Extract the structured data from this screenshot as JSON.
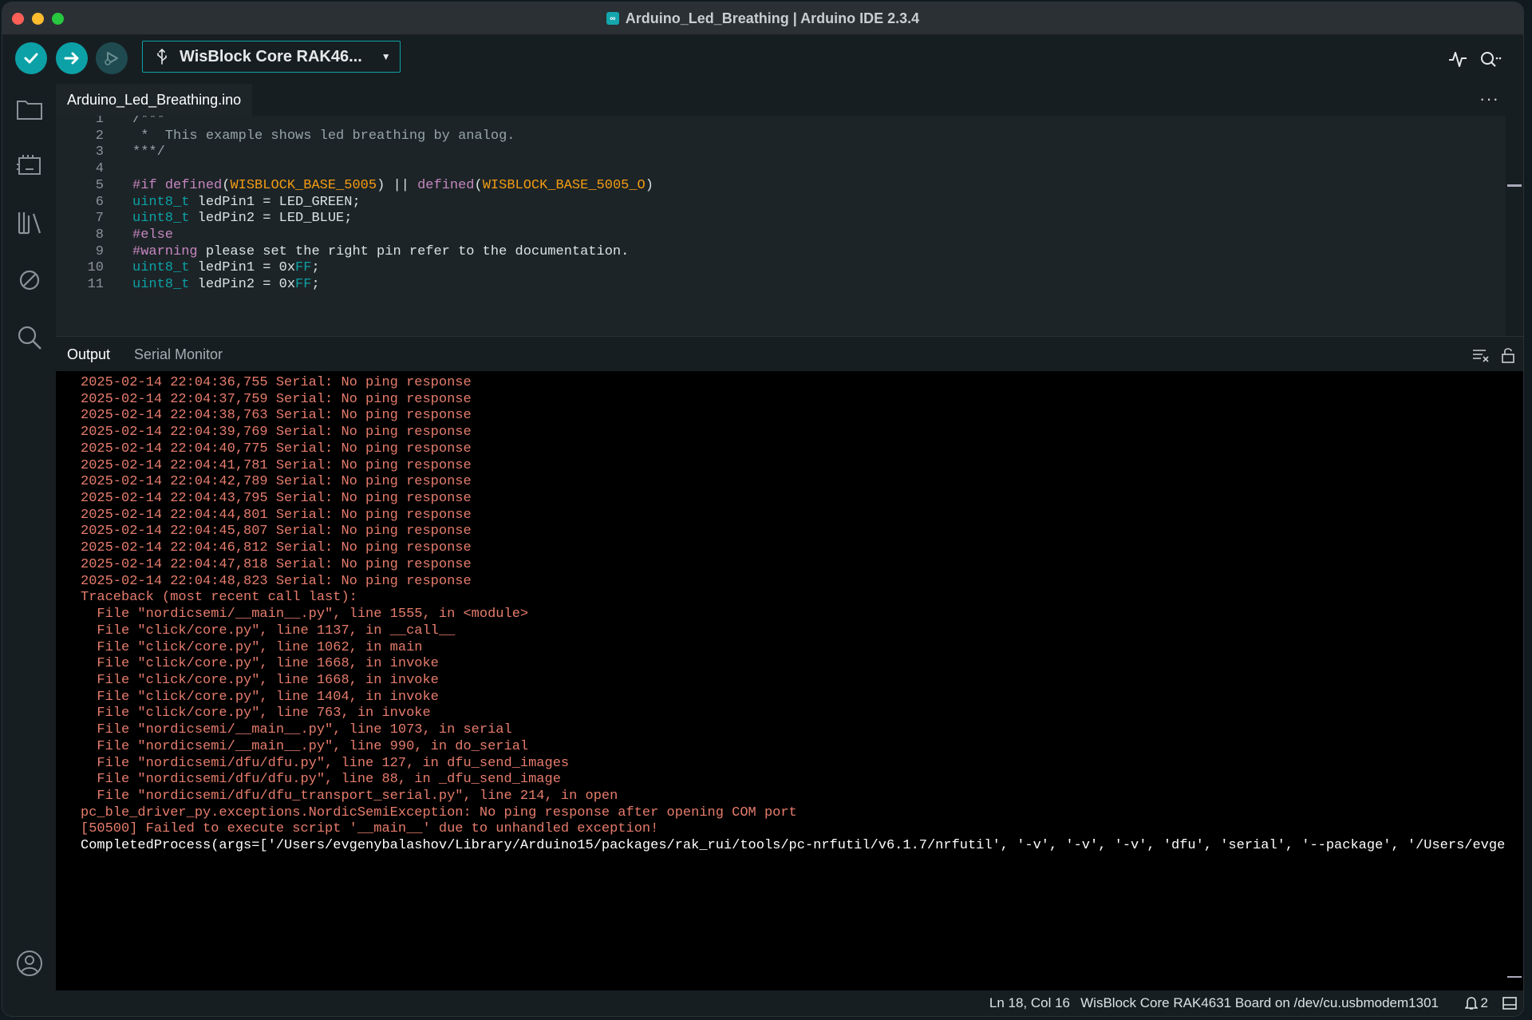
{
  "window": {
    "title": "Arduino_Led_Breathing | Arduino IDE 2.3.4"
  },
  "toolbar": {
    "board_selected": "WisBlock Core RAK46...",
    "icons": [
      "verify-icon",
      "upload-icon",
      "debug-icon",
      "usb-icon",
      "chevron-down-icon",
      "serial-plotter-icon",
      "serial-monitor-icon"
    ]
  },
  "activity_bar": {
    "icons": [
      "folder-icon",
      "boards-manager-icon",
      "library-manager-icon",
      "debug-icon",
      "search-icon",
      "account-icon"
    ]
  },
  "editor": {
    "file_tab": "Arduino_Led_Breathing.ino",
    "more_label": "···",
    "lines": [
      {
        "num": "1",
        "segments": [
          {
            "t": "/***",
            "c": "comment"
          }
        ]
      },
      {
        "num": "2",
        "segments": [
          {
            "t": " *  This example shows led breathing by analog.",
            "c": "comment"
          }
        ]
      },
      {
        "num": "3",
        "segments": [
          {
            "t": "***/",
            "c": "comment"
          }
        ]
      },
      {
        "num": "4",
        "segments": []
      },
      {
        "num": "5",
        "segments": [
          {
            "t": "#if ",
            "c": "pp"
          },
          {
            "t": "defined",
            "c": "pp"
          },
          {
            "t": "(",
            "c": "plain"
          },
          {
            "t": "WISBLOCK_BASE_5005",
            "c": "const"
          },
          {
            "t": ") || ",
            "c": "plain"
          },
          {
            "t": "defined",
            "c": "pp"
          },
          {
            "t": "(",
            "c": "plain"
          },
          {
            "t": "WISBLOCK_BASE_5005_O",
            "c": "const"
          },
          {
            "t": ")",
            "c": "plain"
          }
        ]
      },
      {
        "num": "6",
        "segments": [
          {
            "t": "uint8_t",
            "c": "kw"
          },
          {
            "t": " ledPin1 = LED_GREEN;",
            "c": "plain"
          }
        ]
      },
      {
        "num": "7",
        "segments": [
          {
            "t": "uint8_t",
            "c": "kw"
          },
          {
            "t": " ledPin2 = LED_BLUE;",
            "c": "plain"
          }
        ]
      },
      {
        "num": "8",
        "segments": [
          {
            "t": "#else",
            "c": "pp"
          }
        ]
      },
      {
        "num": "9",
        "segments": [
          {
            "t": "#warning",
            "c": "pp"
          },
          {
            "t": " please set the right pin refer to the documentation.",
            "c": "plain"
          }
        ]
      },
      {
        "num": "10",
        "segments": [
          {
            "t": "uint8_t",
            "c": "kw"
          },
          {
            "t": " ledPin1 = 0x",
            "c": "plain"
          },
          {
            "t": "FF",
            "c": "hex"
          },
          {
            "t": ";",
            "c": "plain"
          }
        ]
      },
      {
        "num": "11",
        "segments": [
          {
            "t": "uint8_t",
            "c": "kw"
          },
          {
            "t": " ledPin2 = 0x",
            "c": "plain"
          },
          {
            "t": "FF",
            "c": "hex"
          },
          {
            "t": ";",
            "c": "plain"
          }
        ]
      }
    ]
  },
  "output_panel": {
    "tabs": [
      {
        "label": "Output",
        "active": true
      },
      {
        "label": "Serial Monitor",
        "active": false
      }
    ],
    "lines": [
      {
        "text": "2025-02-14 22:04:36,755 Serial: No ping response",
        "kind": "err"
      },
      {
        "text": "2025-02-14 22:04:37,759 Serial: No ping response",
        "kind": "err"
      },
      {
        "text": "2025-02-14 22:04:38,763 Serial: No ping response",
        "kind": "err"
      },
      {
        "text": "2025-02-14 22:04:39,769 Serial: No ping response",
        "kind": "err"
      },
      {
        "text": "2025-02-14 22:04:40,775 Serial: No ping response",
        "kind": "err"
      },
      {
        "text": "2025-02-14 22:04:41,781 Serial: No ping response",
        "kind": "err"
      },
      {
        "text": "2025-02-14 22:04:42,789 Serial: No ping response",
        "kind": "err"
      },
      {
        "text": "2025-02-14 22:04:43,795 Serial: No ping response",
        "kind": "err"
      },
      {
        "text": "2025-02-14 22:04:44,801 Serial: No ping response",
        "kind": "err"
      },
      {
        "text": "2025-02-14 22:04:45,807 Serial: No ping response",
        "kind": "err"
      },
      {
        "text": "2025-02-14 22:04:46,812 Serial: No ping response",
        "kind": "err"
      },
      {
        "text": "2025-02-14 22:04:47,818 Serial: No ping response",
        "kind": "err"
      },
      {
        "text": "2025-02-14 22:04:48,823 Serial: No ping response",
        "kind": "err"
      },
      {
        "text": "Traceback (most recent call last):",
        "kind": "err"
      },
      {
        "text": "  File \"nordicsemi/__main__.py\", line 1555, in <module>",
        "kind": "err"
      },
      {
        "text": "  File \"click/core.py\", line 1137, in __call__",
        "kind": "err"
      },
      {
        "text": "  File \"click/core.py\", line 1062, in main",
        "kind": "err"
      },
      {
        "text": "  File \"click/core.py\", line 1668, in invoke",
        "kind": "err"
      },
      {
        "text": "  File \"click/core.py\", line 1668, in invoke",
        "kind": "err"
      },
      {
        "text": "  File \"click/core.py\", line 1404, in invoke",
        "kind": "err"
      },
      {
        "text": "  File \"click/core.py\", line 763, in invoke",
        "kind": "err"
      },
      {
        "text": "  File \"nordicsemi/__main__.py\", line 1073, in serial",
        "kind": "err"
      },
      {
        "text": "  File \"nordicsemi/__main__.py\", line 990, in do_serial",
        "kind": "err"
      },
      {
        "text": "  File \"nordicsemi/dfu/dfu.py\", line 127, in dfu_send_images",
        "kind": "err"
      },
      {
        "text": "  File \"nordicsemi/dfu/dfu.py\", line 88, in _dfu_send_image",
        "kind": "err"
      },
      {
        "text": "  File \"nordicsemi/dfu/dfu_transport_serial.py\", line 214, in open",
        "kind": "err"
      },
      {
        "text": "pc_ble_driver_py.exceptions.NordicSemiException: No ping response after opening COM port",
        "kind": "err"
      },
      {
        "text": "[50500] Failed to execute script '__main__' due to unhandled exception!",
        "kind": "err"
      },
      {
        "text": "CompletedProcess(args=['/Users/evgenybalashov/Library/Arduino15/packages/rak_rui/tools/pc-nrfutil/v6.1.7/nrfutil', '-v', '-v', '-v', 'dfu', 'serial', '--package', '/Users/evgenyb",
        "kind": "norm"
      }
    ]
  },
  "status_bar": {
    "cursor_position": "Ln 18, Col 16",
    "board_port": "WisBlock Core RAK4631 Board on /dev/cu.usbmodem1301",
    "notifications_count": "2"
  },
  "colors": {
    "accent": "#0ca1a6",
    "error_text": "#e67c6c",
    "preprocessor": "#c586c0",
    "constant": "#f39c12"
  }
}
